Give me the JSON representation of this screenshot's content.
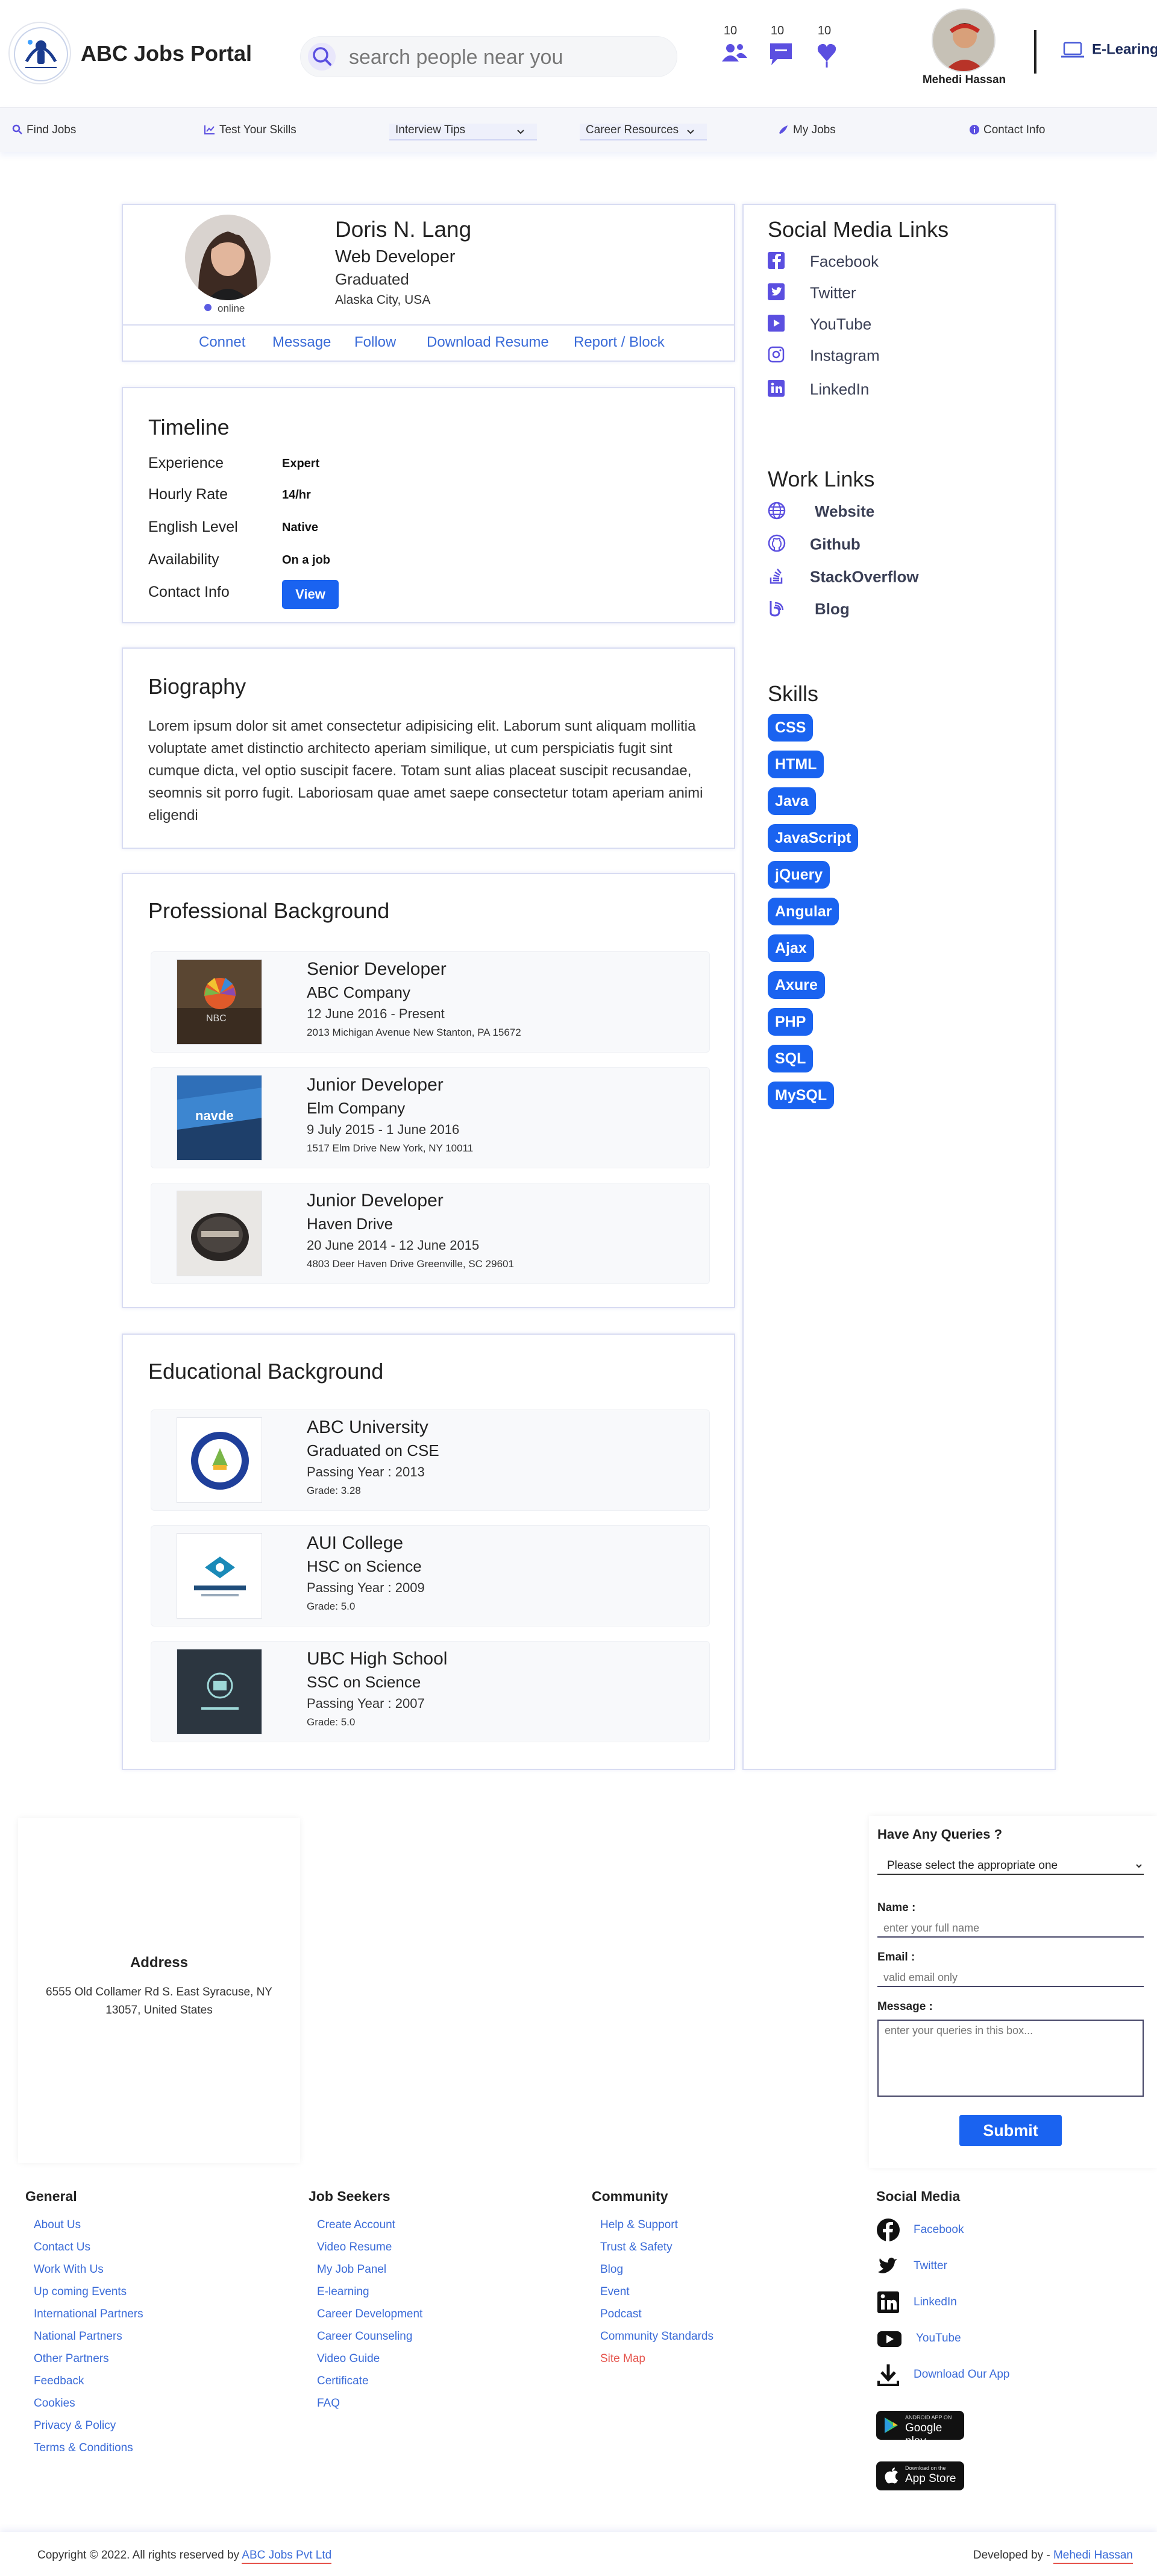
{
  "header": {
    "app_name": "ABC Jobs Portal",
    "search_placeholder": "search people near you",
    "notifications": {
      "people": "10",
      "messages": "10",
      "likes": "10"
    },
    "user_name": "Mehedi Hassan",
    "elearning_label": "E-Learing"
  },
  "nav": {
    "items": [
      {
        "label": "Find Jobs"
      },
      {
        "label": "Test Your Skills"
      },
      {
        "label": "Interview Tips"
      },
      {
        "label": "Career Resources"
      },
      {
        "label": "My Jobs"
      },
      {
        "label": "Contact Info"
      }
    ]
  },
  "profile": {
    "name": "Doris N. Lang",
    "role": "Web Developer",
    "education_status": "Graduated",
    "location": "Alaska City, USA",
    "status": "online",
    "actions": [
      "Connet",
      "Message",
      "Follow",
      "Download Resume",
      "Report / Block"
    ]
  },
  "timeline": {
    "title": "Timeline",
    "rows": [
      {
        "label": "Experience",
        "value": "Expert"
      },
      {
        "label": "Hourly Rate",
        "value": "14/hr"
      },
      {
        "label": "English Level",
        "value": "Native"
      },
      {
        "label": "Availability",
        "value": "On a job"
      }
    ],
    "contact_label": "Contact Info",
    "view_button": "View"
  },
  "biography": {
    "title": "Biography",
    "text": "Lorem ipsum dolor sit amet consectetur adipisicing elit. Laborum sunt aliquam mollitia voluptate amet distinctio architecto aperiam similique, ut cum perspiciatis fugit sint cumque dicta, vel optio suscipit facere. Totam sunt alias placeat suscipit recusandae, seomnis sit porro fugit. Laboriosam quae amet saepe consectetur totam aperiam animi eligendi"
  },
  "professional": {
    "title": "Professional Background",
    "entries": [
      {
        "position": "Senior Developer",
        "company": "ABC Company",
        "period": "12 June 2016 - Present",
        "address": "2013 Michigan Avenue New Stanton, PA 15672"
      },
      {
        "position": "Junior Developer",
        "company": "Elm Company",
        "period": "9 July 2015 - 1 June 2016",
        "address": "1517 Elm Drive New York, NY 10011"
      },
      {
        "position": "Junior Developer",
        "company": "Haven Drive",
        "period": "20 June 2014 - 12 June 2015",
        "address": "4803 Deer Haven Drive Greenville, SC 29601"
      }
    ]
  },
  "educational": {
    "title": "Educational Background",
    "entries": [
      {
        "institution": "ABC University",
        "degree": "Graduated on CSE",
        "year": "Passing Year : 2013",
        "grade": "Grade: 3.28"
      },
      {
        "institution": "AUI College",
        "degree": "HSC on Science",
        "year": "Passing Year : 2009",
        "grade": "Grade: 5.0"
      },
      {
        "institution": "UBC High School",
        "degree": "SSC on Science",
        "year": "Passing Year : 2007",
        "grade": "Grade: 5.0"
      }
    ]
  },
  "sidebar": {
    "social_title": "Social Media Links",
    "social_links": [
      "Facebook",
      "Twitter",
      "YouTube",
      "Instagram",
      "LinkedIn"
    ],
    "work_title": "Work Links",
    "work_links": [
      "Website",
      "Github",
      "StackOverflow",
      "Blog"
    ],
    "skills_title": "Skills",
    "skills": [
      "CSS",
      "HTML",
      "Java",
      "JavaScript",
      "jQuery",
      "Angular",
      "Ajax",
      "Axure",
      "PHP",
      "SQL",
      "MySQL"
    ]
  },
  "address": {
    "title": "Address",
    "text": "6555 Old Collamer Rd S. East Syracuse, NY 13057, United States"
  },
  "query_form": {
    "title": "Have Any Queries ?",
    "select_value": "Please select the appropriate one",
    "name_label": "Name :",
    "name_placeholder": "enter your full name",
    "email_label": "Email :",
    "email_placeholder": "valid email only",
    "message_label": "Message :",
    "message_placeholder": "enter your queries in this box...",
    "submit": "Submit"
  },
  "footer": {
    "general": {
      "title": "General",
      "links": [
        "About Us",
        "Contact Us",
        "Work With Us",
        "Up coming Events",
        "International Partners",
        "National Partners",
        "Other Partners",
        "Feedback",
        "Cookies",
        "Privacy & Policy",
        "Terms & Conditions"
      ]
    },
    "job_seekers": {
      "title": "Job Seekers",
      "links": [
        "Create Account",
        "Video Resume",
        "My Job Panel",
        "E-learning",
        "Career Development",
        "Career Counseling",
        "Video Guide",
        "Certificate",
        "FAQ"
      ]
    },
    "community": {
      "title": "Community",
      "links": [
        "Help & Support",
        "Trust & Safety",
        "Blog",
        "Event",
        "Podcast",
        "Community Standards",
        "Site Map"
      ]
    },
    "social": {
      "title": "Social Media",
      "links": [
        "Facebook",
        "Twitter",
        "LinkedIn",
        "YouTube",
        "Download Our App"
      ]
    },
    "stores": {
      "google": {
        "small": "ANDROID APP ON",
        "big": "Google play"
      },
      "apple": {
        "small": "Download on the",
        "big": "App Store"
      }
    },
    "copyright_prefix": "Copyright © 2022. All rights reserved by",
    "copyright_company": "ABC Jobs Pvt Ltd",
    "developed_prefix": "Developed by -",
    "developer": "Mehedi Hassan"
  },
  "colors": {
    "primary": "#1a63f0",
    "link": "#3a6bd8",
    "icon": "#5b4fe0",
    "accent_red": "#e5534b"
  }
}
